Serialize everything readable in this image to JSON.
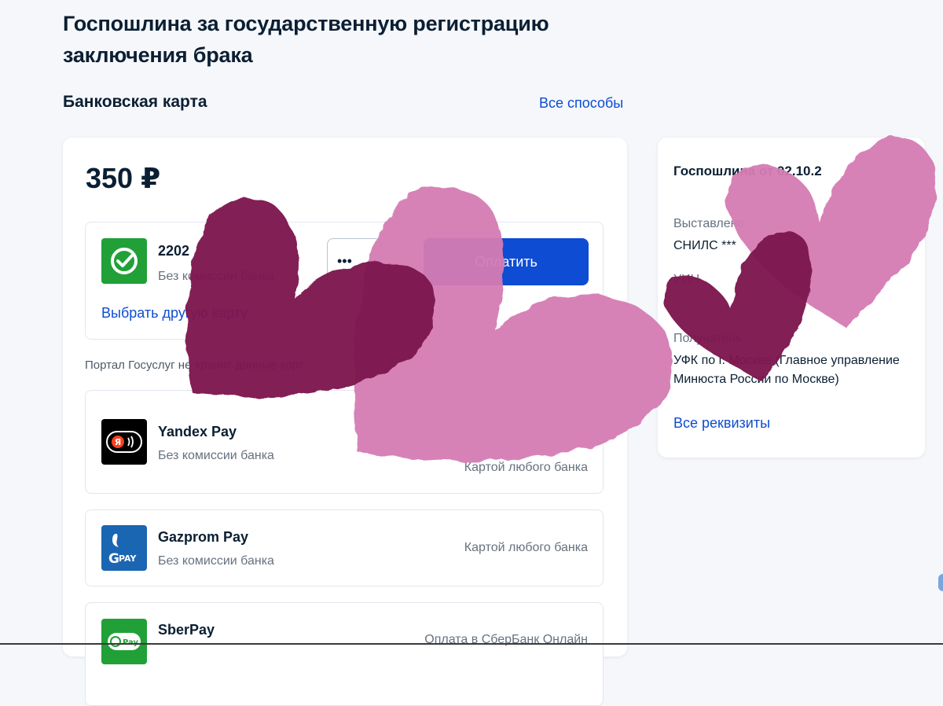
{
  "page": {
    "title": "Госпошлина за государственную регистрацию заключения брака",
    "section_title": "Банковская карта",
    "all_methods_link": "Все способы"
  },
  "payment": {
    "amount": "350 ₽",
    "saved_card": {
      "number_prefix": "2202",
      "subtitle": "Без комиссии банка",
      "choose_other": "Выбрать другую карту",
      "cvc_value": "•••"
    },
    "pay_button": "Оплатить",
    "portal_note": "Портал Госуслуг не хранит данные карт",
    "methods": [
      {
        "name": "Yandex Pay",
        "subtitle": "Без комиссии банка",
        "right": "Картой любого банка",
        "icon": "yandex-pay-icon"
      },
      {
        "name": "Gazprom Pay",
        "subtitle": "Без комиссии банка",
        "right": "Картой любого банка",
        "icon": "gazprom-pay-icon"
      },
      {
        "name": "SberPay",
        "subtitle": "",
        "right": "Оплата в СберБанк Онлайн",
        "icon": "sberpay-icon"
      }
    ]
  },
  "details": {
    "title": "Госпошлина от 02.10.2",
    "issued_label": "Выставлено",
    "snils": "СНИЛС ***",
    "uin_label": "УИН",
    "recipient_label": "Получатель",
    "recipient_value": "УФК по г. Москве (Главное управление Минюста России по Москве)",
    "all_requisites": "Все реквизиты"
  },
  "colors": {
    "accent": "#0d4cd3",
    "sber_green": "#21a038",
    "heart_dark": "#7d1450",
    "heart_light": "#d57bb4"
  }
}
